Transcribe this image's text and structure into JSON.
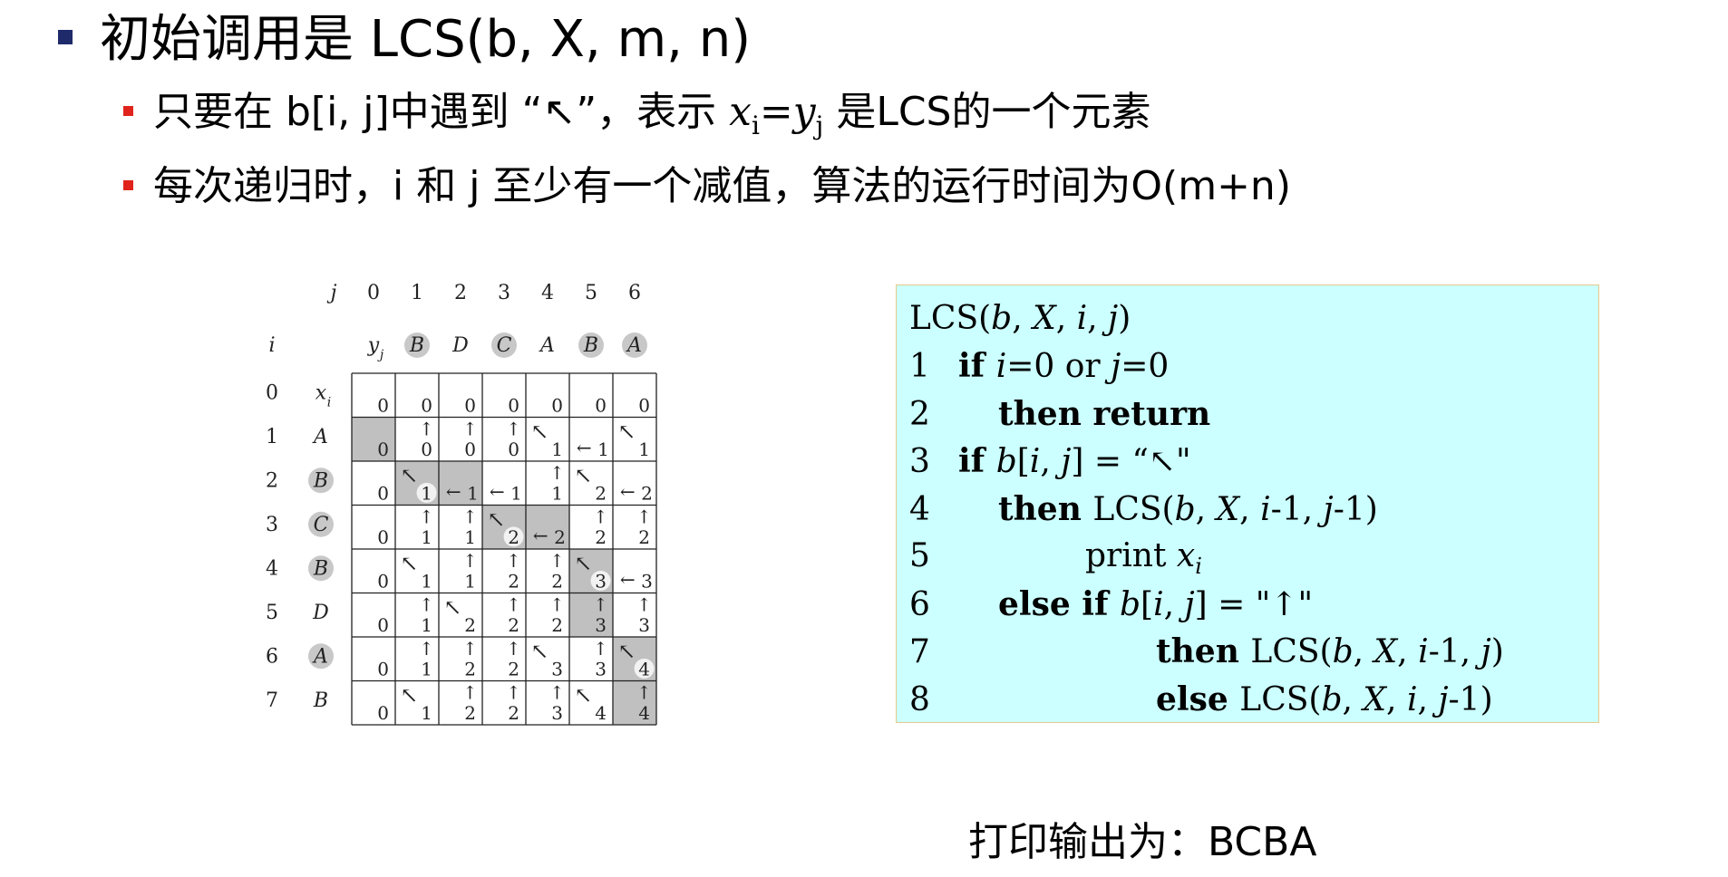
{
  "bullets": {
    "main": "初始调用是 LCS(b, X, m, n)",
    "sub1_pre": "只要在 b[i, j]中遇到 “↖”，表示 ",
    "sub1_x": "x",
    "sub1_xi": "i",
    "sub1_eq": "=",
    "sub1_y": "y",
    "sub1_yj": "j",
    "sub1_post": " 是LCS的一个元素",
    "sub2": "每次递归时，i 和 j 至少有一个减值，算法的运行时间为O(m+n)"
  },
  "table": {
    "j_label": "j",
    "i_label": "i",
    "yj_label": "y",
    "yj_sub": "j",
    "xi_label": "x",
    "xi_sub": "i",
    "col_indices": [
      "0",
      "1",
      "2",
      "3",
      "4",
      "5",
      "6"
    ],
    "row_indices": [
      "0",
      "1",
      "2",
      "3",
      "4",
      "5",
      "6",
      "7"
    ],
    "y": [
      "B",
      "D",
      "C",
      "A",
      "B",
      "A"
    ],
    "y_circled": [
      true,
      false,
      true,
      false,
      true,
      true
    ],
    "x": [
      "A",
      "B",
      "C",
      "B",
      "D",
      "A",
      "B"
    ],
    "x_circled": [
      false,
      true,
      true,
      true,
      false,
      true,
      false
    ],
    "values": [
      [
        0,
        0,
        0,
        0,
        0,
        0,
        0
      ],
      [
        0,
        0,
        0,
        0,
        1,
        1,
        1
      ],
      [
        0,
        1,
        1,
        1,
        1,
        2,
        2
      ],
      [
        0,
        1,
        1,
        2,
        2,
        2,
        2
      ],
      [
        0,
        1,
        1,
        2,
        2,
        3,
        3
      ],
      [
        0,
        1,
        2,
        2,
        2,
        3,
        3
      ],
      [
        0,
        1,
        2,
        2,
        3,
        3,
        4
      ],
      [
        0,
        1,
        2,
        2,
        3,
        4,
        4
      ]
    ],
    "arrows": [
      [
        "",
        "",
        "",
        "",
        "",
        "",
        ""
      ],
      [
        "",
        "up",
        "up",
        "up",
        "diag",
        "left",
        "diag"
      ],
      [
        "",
        "diag",
        "left",
        "left",
        "up",
        "diag",
        "left"
      ],
      [
        "",
        "up",
        "up",
        "diag",
        "left",
        "up",
        "up"
      ],
      [
        "",
        "diag",
        "up",
        "up",
        "up",
        "diag",
        "left"
      ],
      [
        "",
        "up",
        "diag",
        "up",
        "up",
        "up",
        "up"
      ],
      [
        "",
        "up",
        "up",
        "up",
        "diag",
        "up",
        "diag"
      ],
      [
        "",
        "diag",
        "up",
        "up",
        "up",
        "diag",
        "up"
      ]
    ],
    "shaded": [
      [
        1,
        0
      ],
      [
        2,
        1
      ],
      [
        2,
        2
      ],
      [
        3,
        3
      ],
      [
        3,
        4
      ],
      [
        4,
        5
      ],
      [
        5,
        5
      ],
      [
        6,
        6
      ],
      [
        7,
        6
      ]
    ],
    "circled_cells": [
      [
        2,
        1
      ],
      [
        3,
        3
      ],
      [
        4,
        5
      ],
      [
        6,
        6
      ]
    ]
  },
  "code": {
    "header": "LCS(b, X, i, j)",
    "lines": [
      {
        "n": "1",
        "parts": [
          [
            "kw",
            "if "
          ],
          [
            "it",
            "i"
          ],
          [
            "",
            "=0 or "
          ],
          [
            "it",
            "j"
          ],
          [
            "",
            "=0"
          ]
        ]
      },
      {
        "n": "2",
        "parts": [
          [
            "",
            "    "
          ],
          [
            "kw",
            "then return"
          ]
        ]
      },
      {
        "n": "3",
        "parts": [
          [
            "kw",
            "if "
          ],
          [
            "it",
            "b"
          ],
          [
            "",
            "["
          ],
          [
            "it",
            "i"
          ],
          [
            "",
            ", "
          ],
          [
            "it",
            "j"
          ],
          [
            "",
            "] = “↖\""
          ]
        ]
      },
      {
        "n": "4",
        "parts": [
          [
            "kw",
            "then "
          ],
          [
            "",
            "LCS("
          ],
          [
            "it",
            "b"
          ],
          [
            "",
            ", "
          ],
          [
            "it",
            "X"
          ],
          [
            "",
            ", "
          ],
          [
            "it",
            "i"
          ],
          [
            "",
            "-1, "
          ],
          [
            "it",
            "j"
          ],
          [
            "",
            "-1)"
          ]
        ]
      },
      {
        "n": "5",
        "parts": [
          [
            "",
            "print "
          ],
          [
            "it",
            "x"
          ],
          [
            "sub",
            "i"
          ]
        ]
      },
      {
        "n": "6",
        "parts": [
          [
            "kw",
            "else if "
          ],
          [
            "it",
            "b"
          ],
          [
            "",
            "["
          ],
          [
            "it",
            "i"
          ],
          [
            "",
            ", "
          ],
          [
            "it",
            "j"
          ],
          [
            "",
            "] = \"↑\""
          ]
        ]
      },
      {
        "n": "7",
        "parts": [
          [
            "kw",
            "then "
          ],
          [
            "",
            "LCS("
          ],
          [
            "it",
            "b"
          ],
          [
            "",
            ", "
          ],
          [
            "it",
            "X"
          ],
          [
            "",
            ", "
          ],
          [
            "it",
            "i"
          ],
          [
            "",
            "-1, "
          ],
          [
            "it",
            "j"
          ],
          [
            "",
            ")"
          ]
        ]
      },
      {
        "n": "8",
        "parts": [
          [
            "kw",
            "else "
          ],
          [
            "",
            "LCS("
          ],
          [
            "it",
            "b"
          ],
          [
            "",
            ", "
          ],
          [
            "it",
            "X"
          ],
          [
            "",
            ", "
          ],
          [
            "it",
            "i"
          ],
          [
            "",
            ", "
          ],
          [
            "it",
            "j"
          ],
          [
            "",
            "-1)"
          ]
        ]
      }
    ]
  },
  "output": "打印输出为：BCBA",
  "colors": {
    "main_bullet": "#1f2a6b",
    "sub_bullet": "#e0241b",
    "code_bg": "#ccffff",
    "code_border": "#e6c98c",
    "shade": "#c0c0c0"
  }
}
